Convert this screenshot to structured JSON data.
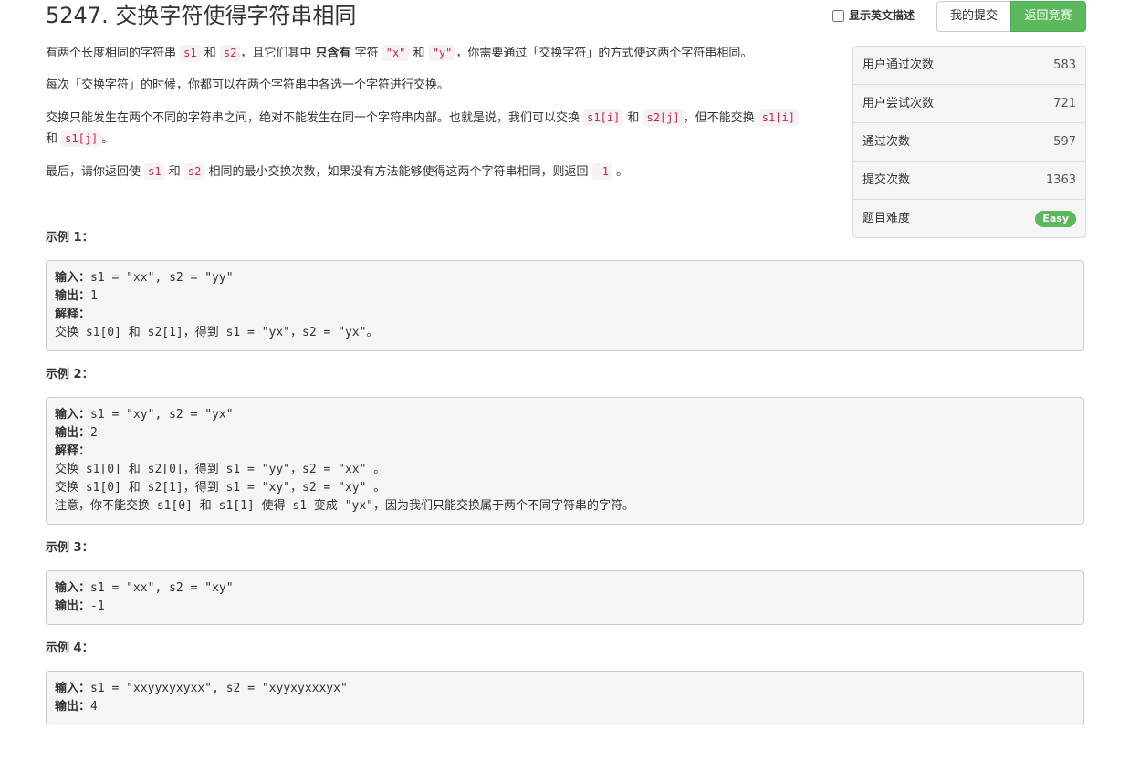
{
  "problem": {
    "title": "5247. 交换字符使得字符串相同"
  },
  "toolbar": {
    "show_english_label": "显示英文描述",
    "my_submissions_label": "我的提交",
    "back_to_contest_label": "返回竞赛"
  },
  "description": {
    "p1": {
      "t1": "有两个长度相同的字符串 ",
      "c1": "s1",
      "t2": " 和 ",
      "c2": "s2",
      "t3": "，且它们其中 ",
      "b1": "只含有",
      "t4": " 字符 ",
      "c3": "\"x\"",
      "t5": " 和 ",
      "c4": "\"y\"",
      "t6": "，你需要通过「交换字符」的方式使这两个字符串相同。"
    },
    "p2": "每次「交换字符」的时候，你都可以在两个字符串中各选一个字符进行交换。",
    "p3": {
      "t1": "交换只能发生在两个不同的字符串之间，绝对不能发生在同一个字符串内部。也就是说，我们可以交换 ",
      "c1": "s1[i]",
      "t2": " 和 ",
      "c2": "s2[j]",
      "t3": "，但不能交换 ",
      "c3": "s1[i]",
      "t4": " 和 ",
      "c4": "s1[j]",
      "t5": "。"
    },
    "p4": {
      "t1": "最后，请你返回使 ",
      "c1": "s1",
      "t2": " 和 ",
      "c2": "s2",
      "t3": " 相同的最小交换次数，如果没有方法能够使得这两个字符串相同，则返回 ",
      "c3": "-1",
      "t4": " 。"
    }
  },
  "stats": [
    {
      "label": "用户通过次数",
      "value": "583"
    },
    {
      "label": "用户尝试次数",
      "value": "721"
    },
    {
      "label": "通过次数",
      "value": "597"
    },
    {
      "label": "提交次数",
      "value": "1363"
    },
    {
      "label": "题目难度",
      "value": "Easy"
    }
  ],
  "examples": [
    {
      "label": "示例 1：",
      "input_key": "输入：",
      "input": "s1 = \"xx\", s2 = \"yy\"",
      "output_key": "输出：",
      "output": "1",
      "explain_key": "解释：",
      "explain_lines": [
        "交换 s1[0] 和 s2[1]，得到 s1 = \"yx\"，s2 = \"yx\"。"
      ]
    },
    {
      "label": "示例 2：",
      "input_key": "输入：",
      "input": "s1 = \"xy\", s2 = \"yx\"",
      "output_key": "输出：",
      "output": "2",
      "explain_key": "解释：",
      "explain_lines": [
        "交换 s1[0] 和 s2[0]，得到 s1 = \"yy\"，s2 = \"xx\" 。",
        "交换 s1[0] 和 s2[1]，得到 s1 = \"xy\"，s2 = \"xy\" 。",
        "注意，你不能交换 s1[0] 和 s1[1] 使得 s1 变成 \"yx\"，因为我们只能交换属于两个不同字符串的字符。"
      ]
    },
    {
      "label": "示例 3：",
      "input_key": "输入：",
      "input": "s1 = \"xx\", s2 = \"xy\"",
      "output_key": "输出：",
      "output": "-1"
    },
    {
      "label": "示例 4：",
      "input_key": "输入：",
      "input": "s1 = \"xxyyxyxyxx\", s2 = \"xyyxyxxxyx\"",
      "output_key": "输出：",
      "output": "4"
    }
  ],
  "colors": {
    "success": "#5cb85c",
    "code_text": "#c7254e",
    "code_bg": "#f9f2f4",
    "panel_bg": "#f5f5f5"
  }
}
